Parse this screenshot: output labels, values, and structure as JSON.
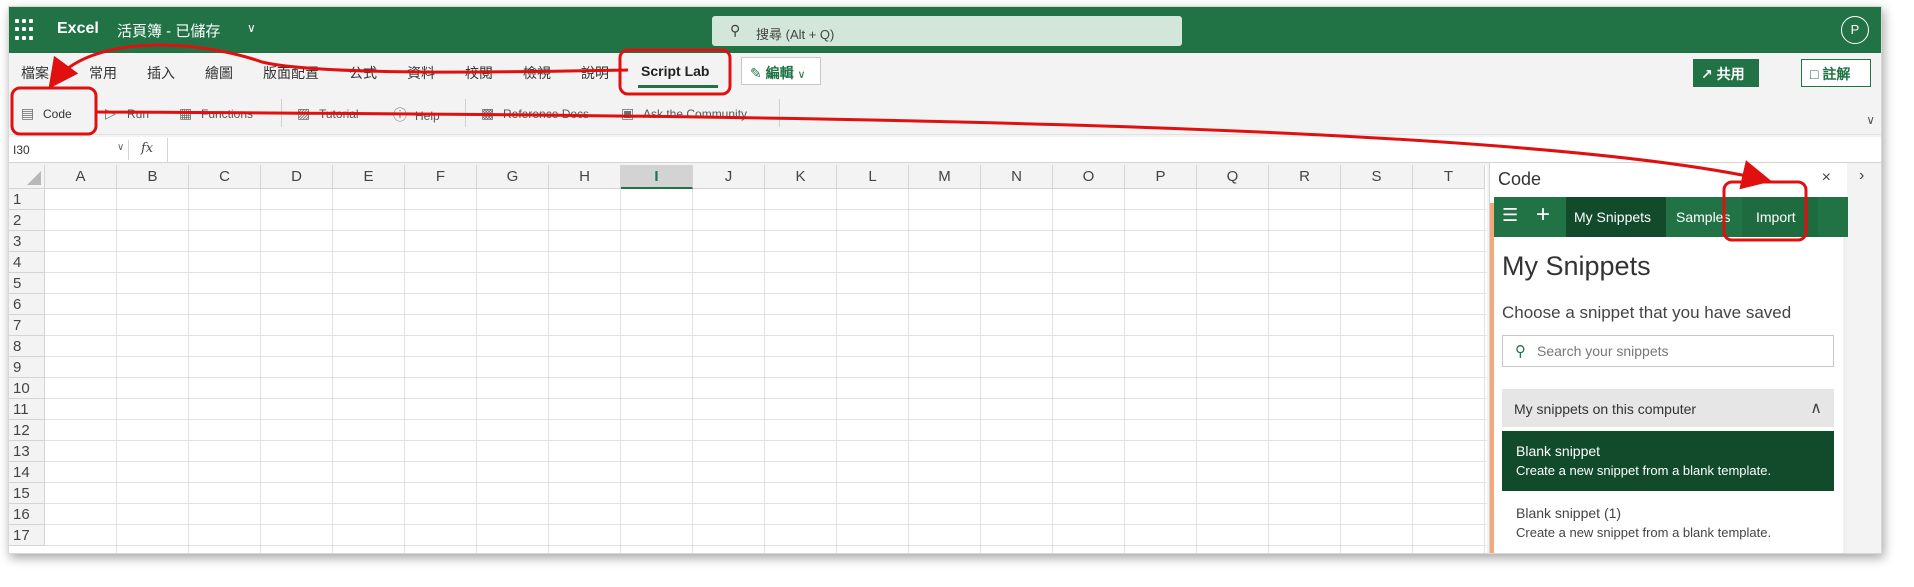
{
  "titlebar": {
    "app_name": "Excel",
    "doc_name": "活頁簿 - 已儲存",
    "search_placeholder": "搜尋 (Alt + Q)",
    "avatar_initial": "P"
  },
  "ribbon_tabs": {
    "file": "檔案",
    "home": "常用",
    "insert": "插入",
    "draw": "繪圖",
    "page_layout": "版面配置",
    "formulas": "公式",
    "data": "資料",
    "review": "校閱",
    "view": "檢視",
    "help": "說明",
    "script_lab": "Script Lab",
    "edit": "編輯",
    "share": "共用",
    "comments": "註解"
  },
  "ribbon_commands": {
    "code": "Code",
    "run": "Run",
    "functions": "Functions",
    "tutorial": "Tutorial",
    "help": "Help",
    "reference_docs": "Reference Docs",
    "ask_community": "Ask the Community"
  },
  "formula_bar": {
    "name_box": "I30",
    "fx": "fx",
    "formula": ""
  },
  "grid": {
    "columns": [
      "A",
      "B",
      "C",
      "D",
      "E",
      "F",
      "G",
      "H",
      "I",
      "J",
      "K",
      "L",
      "M",
      "N",
      "O",
      "P",
      "Q",
      "R",
      "S",
      "T"
    ],
    "selected_column": "I",
    "rows": [
      "1",
      "2",
      "3",
      "4",
      "5",
      "6",
      "7",
      "8",
      "9",
      "10",
      "11",
      "12",
      "13",
      "14",
      "15",
      "16",
      "17"
    ]
  },
  "task_pane": {
    "title": "Code",
    "close": "×",
    "tabs": {
      "my_snippets": "My Snippets",
      "samples": "Samples",
      "import": "Import"
    },
    "heading": "My Snippets",
    "subheading": "Choose a snippet that you have saved",
    "search_placeholder": "Search your snippets",
    "group_title": "My snippets on this computer",
    "snippets": [
      {
        "title": "Blank snippet",
        "desc": "Create a new snippet from a blank template."
      },
      {
        "title": "Blank snippet (1)",
        "desc": "Create a new snippet from a blank template."
      }
    ]
  },
  "icons": {
    "app_launcher": "waffle-icon",
    "search": "search-icon",
    "pencil": "pencil-icon",
    "share": "share-icon",
    "comment": "comment-icon",
    "menu": "hamburger-icon",
    "add": "plus-icon",
    "collapse": "chevron-up-icon"
  },
  "colors": {
    "excel_green": "#217346",
    "dark_green": "#124b2b",
    "annotation_red": "#e01010"
  }
}
